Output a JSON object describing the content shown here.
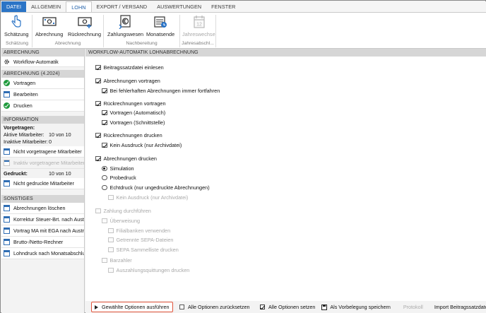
{
  "menu": {
    "tabs": [
      "DATEI",
      "ALLGEMEIN",
      "LOHN",
      "EXPORT / VERSAND",
      "AUSWERTUNGEN",
      "FENSTER"
    ],
    "active_tab": "LOHN"
  },
  "ribbon": {
    "buttons": {
      "schaetzung": "Schätzung",
      "abrechnung": "Abrechnung",
      "rueckrechnung": "Rückrechnung",
      "zahlungswesen": "Zahlungswesen",
      "monatsende": "Monatsende",
      "jahreswechsel": "Jahreswechsel",
      "jahreswechsel_icon_text": "12"
    },
    "groups": {
      "schaetzung": "Schätzung",
      "abrechnung": "Abrechnung",
      "nachbereitung": "Nachbereitung",
      "jahresabschluss": "Jahresabschl..."
    }
  },
  "sidebar": {
    "abrechnung_header": "ABRECHNUNG",
    "workflow_item": "Workflow-Automatik",
    "period_header": "ABRECHNUNG (4.2024)",
    "steps": [
      "Vortragen",
      "Bearbeiten",
      "Drucken"
    ],
    "info_header": "INFORMATION",
    "vorgetragen_label": "Vorgetragen:",
    "aktive_label": "Aktive Mitarbeiter:",
    "aktive_value": "10 von 10",
    "inaktive_label": "Inaktive Mitarbeiter:",
    "inaktive_value": "0",
    "nicht_vorgetragene": "Nicht vorgetragene Mitarbeiter",
    "inaktiv_vorgetragene": "Inaktiv vorgetragene Mitarbeiter",
    "gedruckt_label": "Gedruckt:",
    "gedruckt_value": "10 von 10",
    "nicht_gedruckte": "Nicht gedruckte Mitarbeiter",
    "sonstiges_header": "SONSTIGES",
    "sonstiges": [
      "Abrechnungen löschen",
      "Korrektur Steuer-Brt. nach Austritt",
      "Vortrag MA mit EGA nach Austritt",
      "Brutto-/Netto-Rechner",
      "Lohndruck nach Monatsabschluss"
    ]
  },
  "main": {
    "header": "WORKFLOW-AUTOMATIK LOHNABRECHNUNG",
    "options": {
      "beitragssatz": "Beitragssatzdatei einlesen",
      "abr_vortragen": "Abrechnungen vortragen",
      "bei_fehlerhaften": "Bei fehlerhaften Abrechnungen immer fortfahren",
      "rueck_vortragen": "Rückrechnungen vortragen",
      "vortragen_auto": "Vortragen (Automatisch)",
      "vortragen_schnitt": "Vortragen (Schnittstelle)",
      "rueck_drucken": "Rückrechnungen drucken",
      "kein_ausdruck_1": "Kein Ausdruck (nur Archivdatei)",
      "abr_drucken": "Abrechnungen drucken",
      "simulation": "Simulation",
      "probedruck": "Probedruck",
      "echtdruck": "Echtdruck (nur ungedruckte Abrechnungen)",
      "kein_ausdruck_2": "Kein Ausdruck (nur Archivdatei)",
      "zahlung": "Zahlung durchführen",
      "ueberweisung": "Überweisung",
      "filialbanken": "Filialbanken verwenden",
      "getrennte_sepa": "Getrennte SEPA-Dateien",
      "sepa_sammelliste": "SEPA Sammelliste drucken",
      "barzahler": "Barzahler",
      "auszahlungsquittungen": "Auszahlungsquittungen drucken"
    }
  },
  "bottom": {
    "run": "Gewählte Optionen ausführen",
    "reset_all": "Alle Optionen zurücksetzen",
    "set_all": "Alle Optionen setzen",
    "save_default": "Als Vorbelegung speichern",
    "protokoll": "Protokoll",
    "import": "Import Beitragssatzdateien"
  },
  "colors": {
    "accent": "#2b74c6",
    "run_border": "#e0533a",
    "step_ok": "#1f9a3c"
  }
}
